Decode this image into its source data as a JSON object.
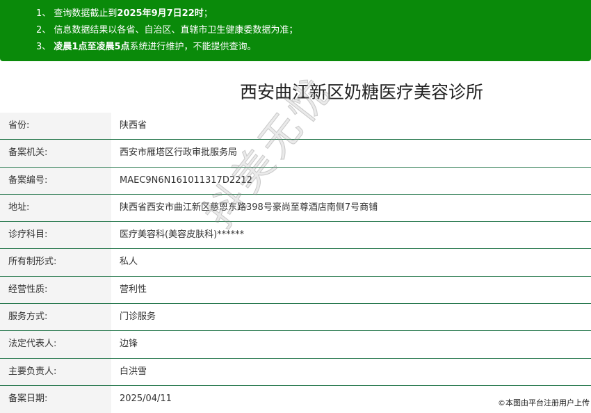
{
  "notice": {
    "line1_prefix": "1、 查询数据截止到",
    "line1_bold": "2025年9月7日22时",
    "line1_suffix": "；",
    "line2": "2、 信息数据结果以各省、自治区、直辖市卫生健康委数据为准；",
    "line3_prefix": "3、 ",
    "line3_bold": "凌晨1点至凌晨5点",
    "line3_suffix": "系统进行维护，不能提供查询。"
  },
  "title": "西安曲江新区奶糖医疗美容诊所",
  "rows": [
    {
      "label": "省份:",
      "value": "陕西省"
    },
    {
      "label": "备案机关:",
      "value": "西安市雁塔区行政审批服务局"
    },
    {
      "label": "备案编号:",
      "value": "MAEC9N6N161011317D2212"
    },
    {
      "label": "地址:",
      "value": "陕西省西安市曲江新区慈恩东路398号豪尚至尊酒店南侧7号商铺"
    },
    {
      "label": "诊疗科目:",
      "value": "医疗美容科(美容皮肤科)******"
    },
    {
      "label": "所有制形式:",
      "value": "私人"
    },
    {
      "label": "经营性质:",
      "value": "营利性"
    },
    {
      "label": "服务方式:",
      "value": "门诊服务"
    },
    {
      "label": "法定代表人:",
      "value": "边锋"
    },
    {
      "label": "主要负责人:",
      "value": "白洪雪"
    },
    {
      "label": "备案日期:",
      "value": "2025/04/11"
    }
  ],
  "watermark": "抖美无忧",
  "copyright": "©本图由平台注册用户上传"
}
